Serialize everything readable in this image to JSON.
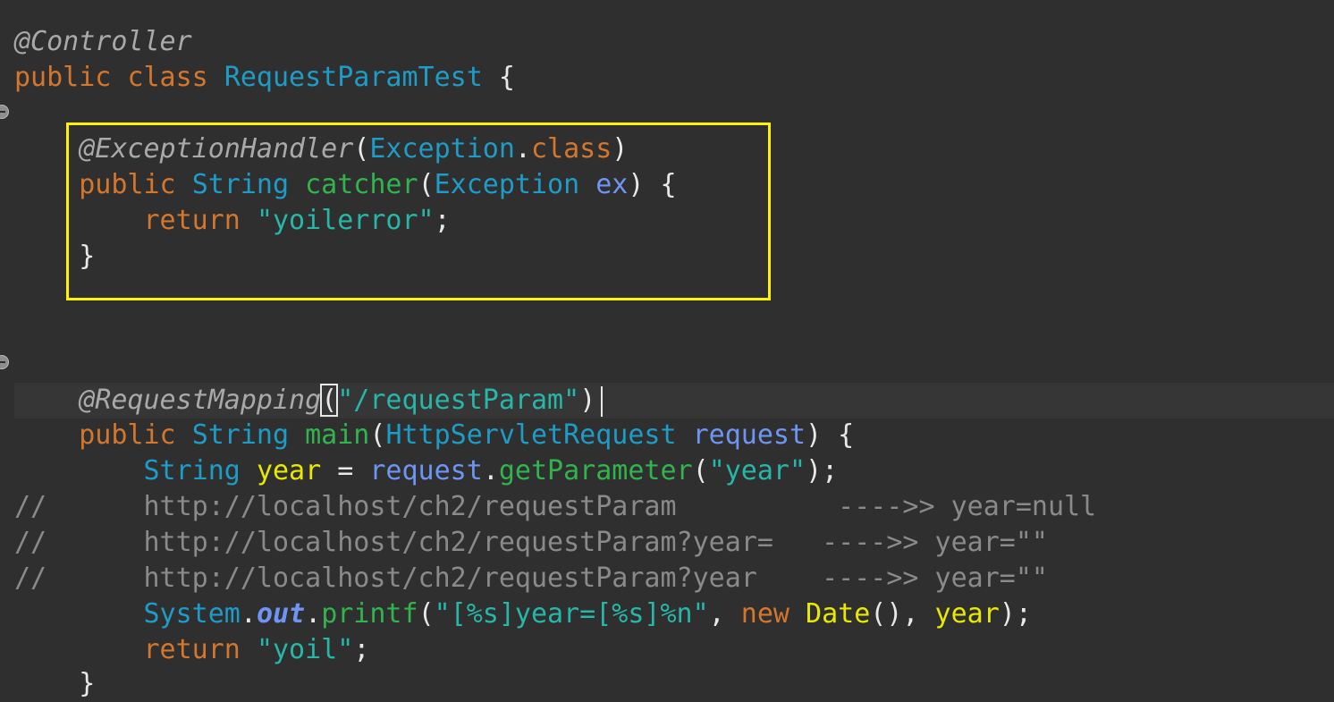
{
  "code": {
    "l1": {
      "annotation": "@Controller"
    },
    "l2": {
      "kw1": "public",
      "kw2": "class",
      "type": "RequestParamTest",
      "brace": "{"
    },
    "l4": {
      "annotation": "@ExceptionHandler",
      "p1": "(",
      "type": "Exception",
      "dot": ".",
      "kw": "class",
      "p2": ")"
    },
    "l5": {
      "kw": "public",
      "type1": "String",
      "method": "catcher",
      "p1": "(",
      "type2": "Exception",
      "param": "ex",
      "p2": ") {"
    },
    "l6": {
      "kw": "return",
      "str": "\"yoilerror\"",
      "semi": ";"
    },
    "l7": {
      "brace": "}"
    },
    "l11": {
      "annotation": "@RequestMapping",
      "p1": "(",
      "str": "\"/requestParam\"",
      "p2": ")"
    },
    "l12": {
      "kw": "public",
      "type1": "String",
      "method": "main",
      "p1": "(",
      "type2": "HttpServletRequest",
      "param": "request",
      "p2": ") {"
    },
    "l13": {
      "type": "String",
      "local": "year",
      "eq": " = ",
      "param": "request",
      "dot": ".",
      "method": "getParameter",
      "p1": "(",
      "str": "\"year\"",
      "p2": ");"
    },
    "l14": {
      "text": "//      http://localhost/ch2/requestParam          ---->> year=null"
    },
    "l15": {
      "text": "//      http://localhost/ch2/requestParam?year=   ---->> year=\"\""
    },
    "l16": {
      "text": "//      http://localhost/ch2/requestParam?year    ---->> year=\"\""
    },
    "l17": {
      "type": "System",
      "dot1": ".",
      "field": "out",
      "dot2": ".",
      "method": "printf",
      "p1": "(",
      "str": "\"[%s]year=[%s]%n\"",
      "comma1": ", ",
      "kw": "new",
      "ctor": "Date",
      "p2": "()",
      "comma2": ", ",
      "local": "year",
      "p3": ");"
    },
    "l18": {
      "kw": "return",
      "str": "\"yoil\"",
      "semi": ";"
    },
    "l19": {
      "brace": "}"
    }
  }
}
